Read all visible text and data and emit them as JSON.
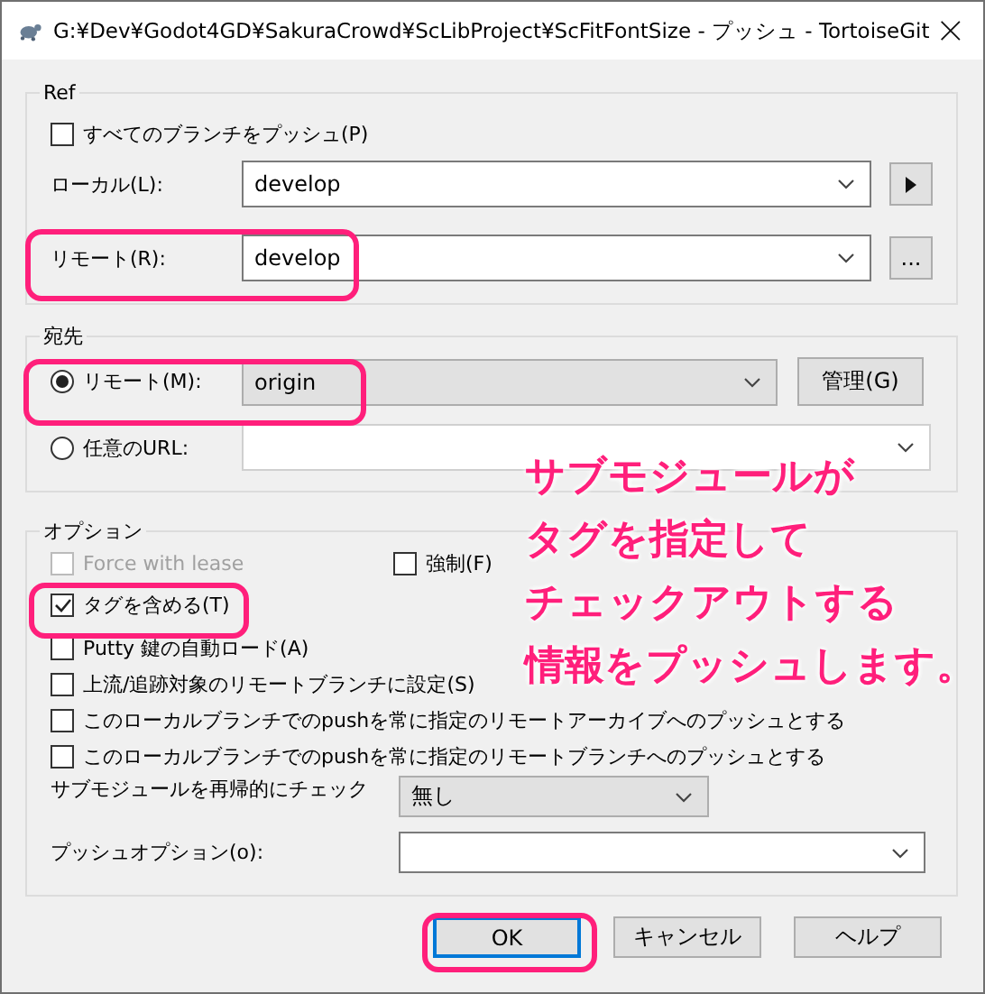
{
  "window": {
    "title": "G:¥Dev¥Godot4GD¥SakuraCrowd¥ScLibProject¥ScFitFontSize - プッシュ - TortoiseGit"
  },
  "ref": {
    "title": "Ref",
    "push_all": {
      "label": "すべてのブランチをプッシュ(P)",
      "checked": false
    },
    "local": {
      "label": "ローカル(L):",
      "value": "develop"
    },
    "remote": {
      "label": "リモート(R):",
      "value": "develop",
      "button": "..."
    }
  },
  "destination": {
    "title": "宛先",
    "choices": [
      {
        "label": "リモート(M):",
        "selected": true,
        "value": "origin",
        "button": "管理(G)"
      },
      {
        "label": "任意のURL:",
        "selected": false
      }
    ]
  },
  "options": {
    "title": "オプション",
    "rows": [
      [
        {
          "label": "Force with lease",
          "checked": false,
          "disabled": true
        },
        {
          "label": "強制(F)",
          "checked": false,
          "disabled": false
        }
      ],
      [
        {
          "label": "タグを含める(T)",
          "checked": true,
          "disabled": false
        }
      ],
      [
        {
          "label": "Putty 鍵の自動ロード(A)",
          "checked": false,
          "disabled": false
        }
      ],
      [
        {
          "label": "上流/追跡対象のリモートブランチに設定(S)",
          "checked": false,
          "disabled": false
        }
      ],
      [
        {
          "label": "このローカルブランチでのpushを常に指定のリモートアーカイブへのプッシュとする",
          "checked": false,
          "disabled": false
        }
      ],
      [
        {
          "label": "このローカルブランチでのpushを常に指定のリモートブランチへのプッシュとする",
          "checked": false,
          "disabled": false
        }
      ]
    ],
    "submodule": {
      "label": "サブモジュールを再帰的にチェック",
      "value": "無し"
    },
    "push_option": {
      "label": "プッシュオプション(o):"
    }
  },
  "buttons": [
    {
      "label": "OK",
      "default": true
    },
    {
      "label": "キャンセル",
      "default": false
    },
    {
      "label": "ヘルプ",
      "default": false
    }
  ],
  "callout": [
    "サブモジュールが",
    "タグを指定して",
    "チェックアウトする",
    "情報をプッシュします。"
  ]
}
